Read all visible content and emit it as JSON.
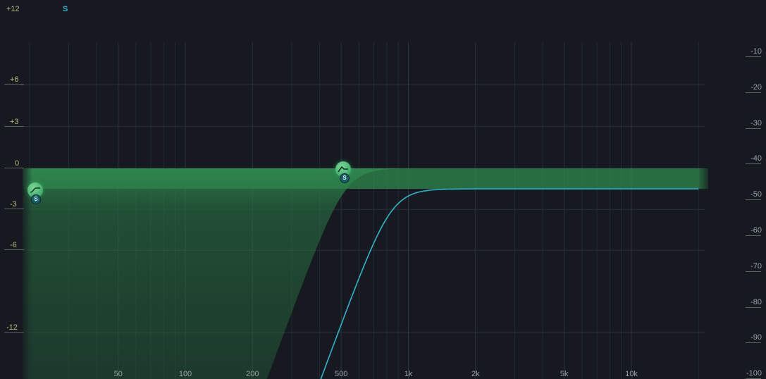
{
  "colors": {
    "background": "#161a20",
    "grid": "#2a3036",
    "band_fill": "#2f8a4e",
    "response_curve": "#2ab7c9",
    "gain_label": "#b7bd7a",
    "db_label": "#9aa0a8"
  },
  "header": {
    "solo_indicator": "S"
  },
  "gain_axis": [
    {
      "value": 12,
      "label": "+12"
    },
    {
      "value": 6,
      "label": "+6"
    },
    {
      "value": 3,
      "label": "+3"
    },
    {
      "value": 0,
      "label": "0"
    },
    {
      "value": -3,
      "label": "-3"
    },
    {
      "value": -6,
      "label": "-6"
    },
    {
      "value": -12,
      "label": "-12"
    }
  ],
  "db_axis": [
    {
      "value": -10,
      "label": "-10"
    },
    {
      "value": -20,
      "label": "-20"
    },
    {
      "value": -30,
      "label": "-30"
    },
    {
      "value": -40,
      "label": "-40"
    },
    {
      "value": -50,
      "label": "-50"
    },
    {
      "value": -60,
      "label": "-60"
    },
    {
      "value": -70,
      "label": "-70"
    },
    {
      "value": -80,
      "label": "-80"
    },
    {
      "value": -90,
      "label": "-90"
    },
    {
      "value": -100,
      "label": "-100"
    }
  ],
  "freq_axis": [
    {
      "value": 50,
      "label": "50"
    },
    {
      "value": 100,
      "label": "100"
    },
    {
      "value": 200,
      "label": "200"
    },
    {
      "value": 500,
      "label": "500"
    },
    {
      "value": 1000,
      "label": "1k"
    },
    {
      "value": 2000,
      "label": "2k"
    },
    {
      "value": 5000,
      "label": "5k"
    },
    {
      "value": 10000,
      "label": "10k"
    }
  ],
  "bands": [
    {
      "name": "low-shelf",
      "frequency_hz": 20,
      "gain_db": -1.5,
      "solo_label": "S",
      "icon": "shelf-icon"
    },
    {
      "name": "high-pass",
      "frequency_hz": 500,
      "gain_db": 0,
      "solo_label": "S",
      "icon": "peak-icon"
    }
  ]
}
